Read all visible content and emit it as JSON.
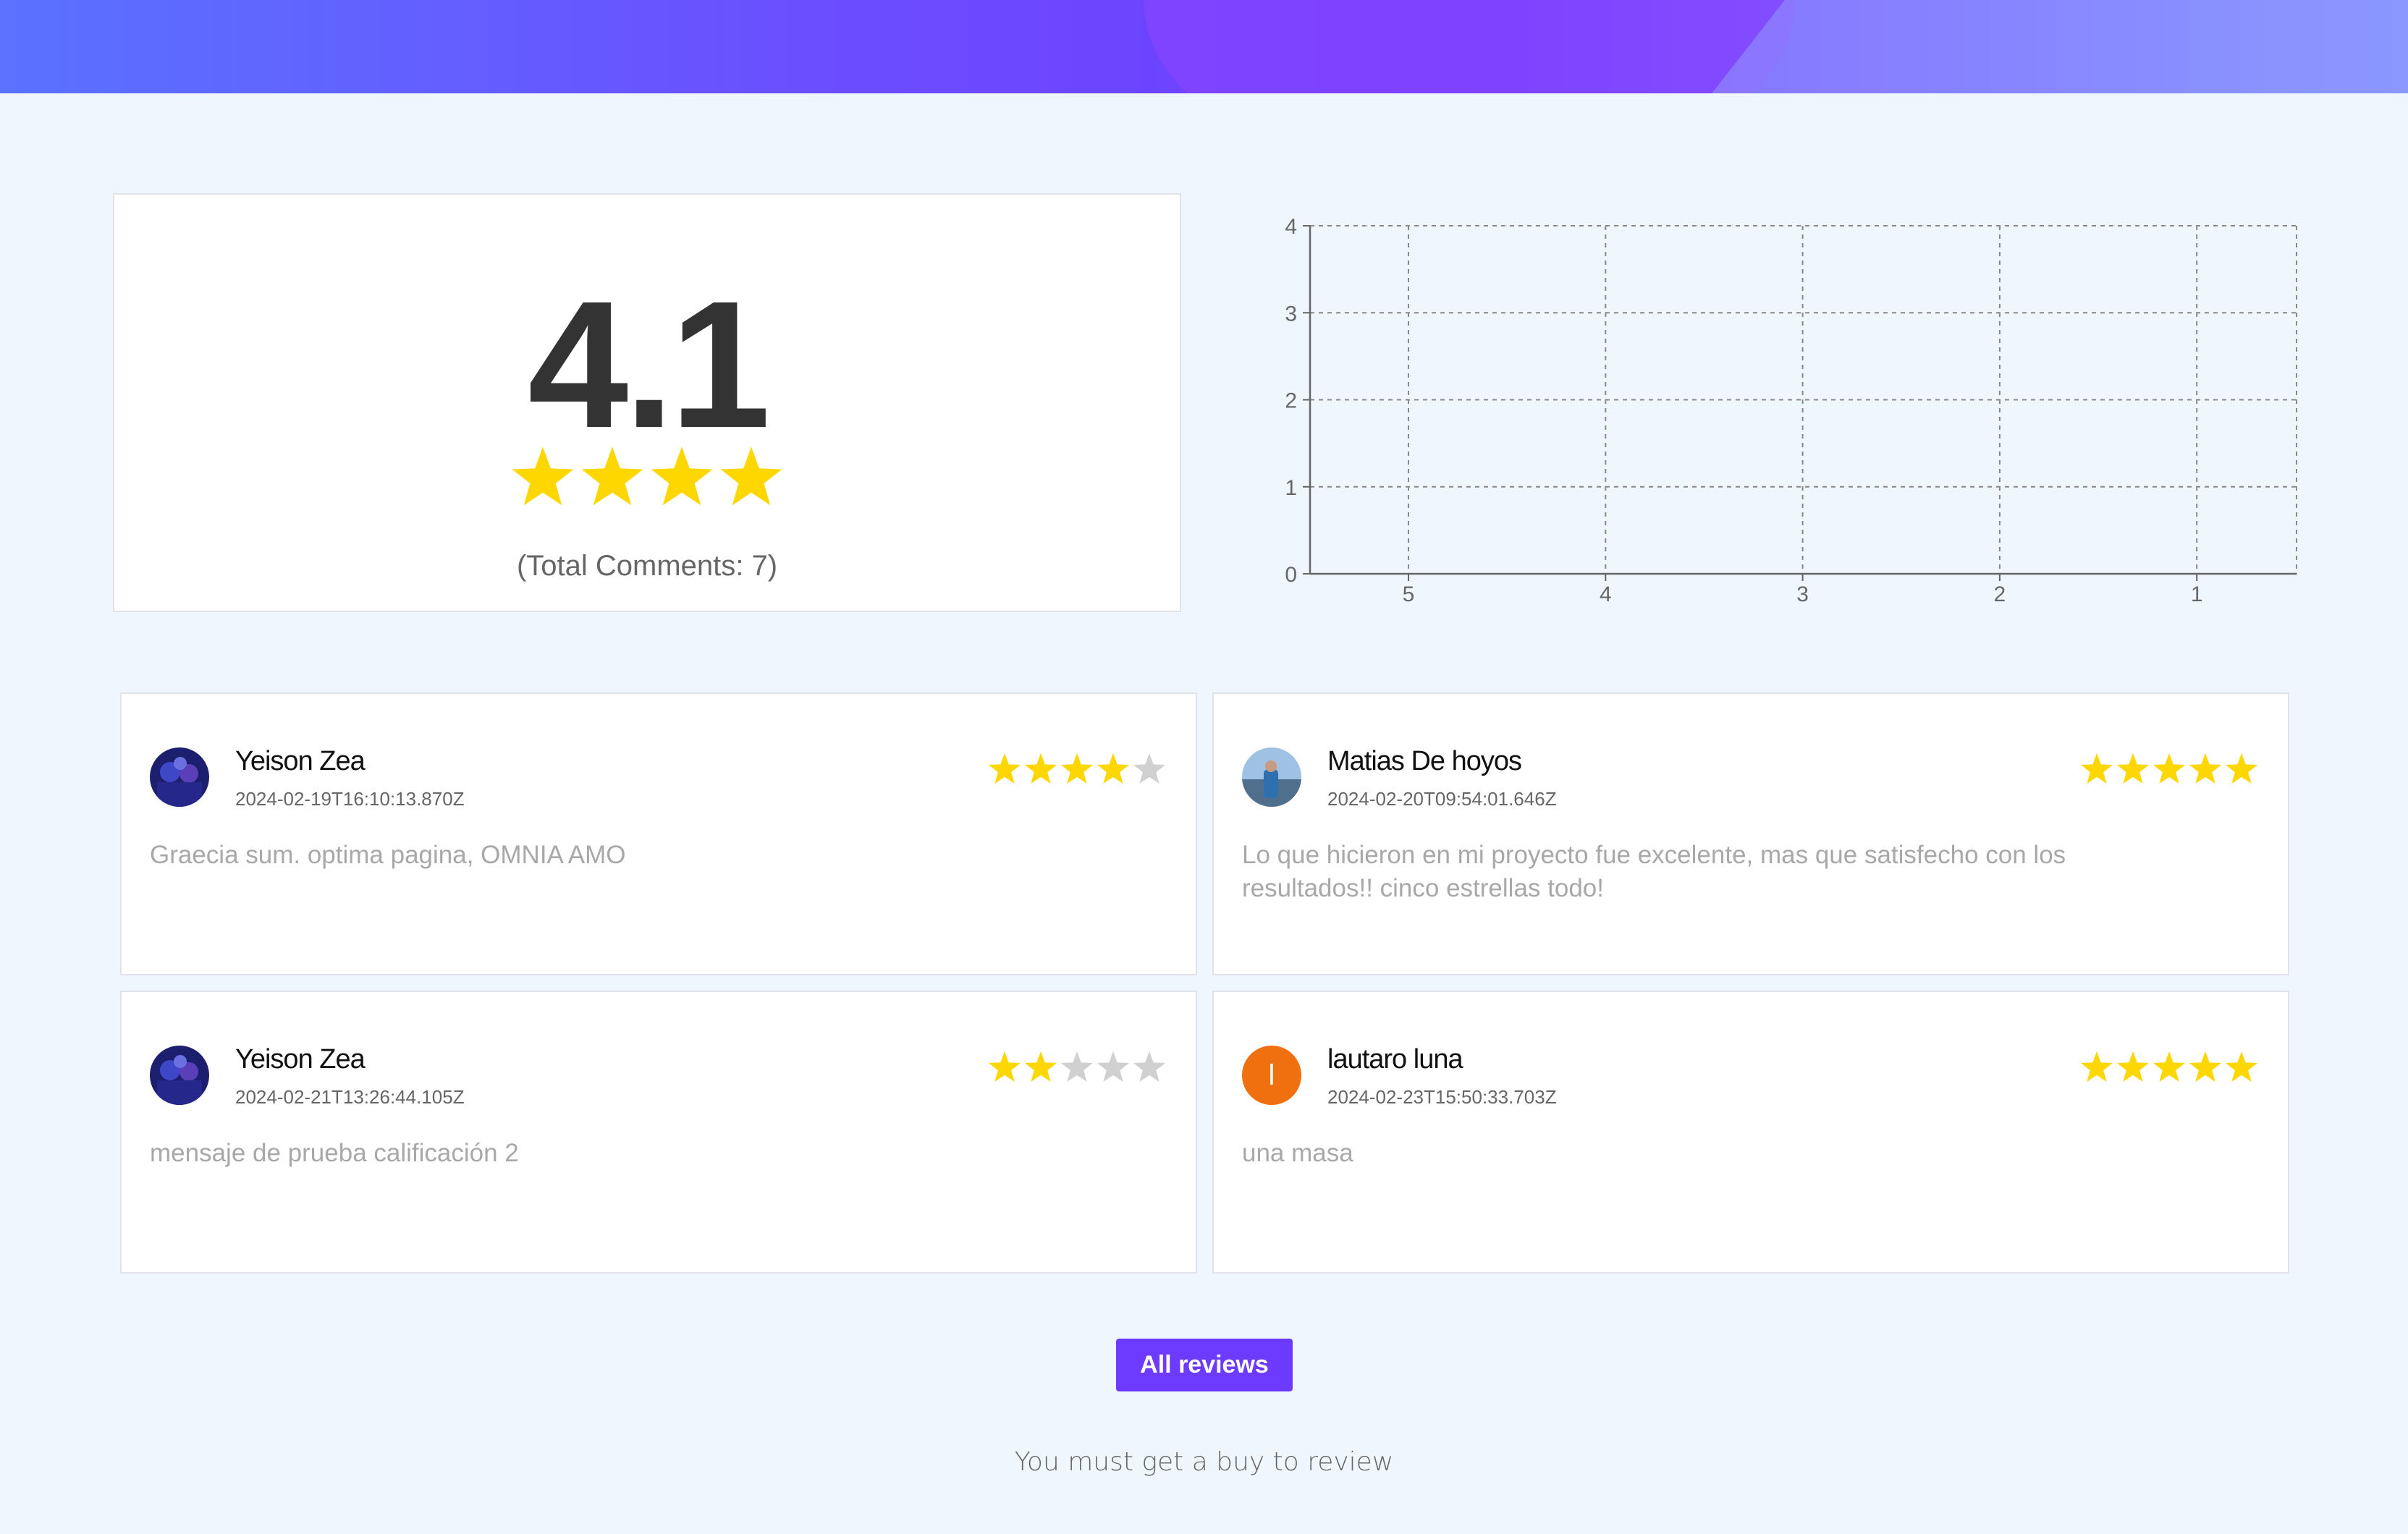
{
  "header": {
    "colors": {
      "start": "#5a72ff",
      "mid": "#6e3cff",
      "end": "#7f8aff"
    }
  },
  "summary": {
    "rating": "4.1",
    "filled_stars": 4,
    "total_comments": "(Total Comments: 7)",
    "star_color": "#ffd700"
  },
  "chart_data": {
    "type": "bar",
    "categories": [
      "5",
      "4",
      "3",
      "2",
      "1"
    ],
    "values": [
      0,
      0,
      0,
      0,
      0
    ],
    "ylim": [
      0,
      4
    ],
    "yticks": [
      "0",
      "1",
      "2",
      "3",
      "4"
    ],
    "grid": true
  },
  "reviews": [
    {
      "name": "Yeison Zea",
      "date": "2024-02-19T16:10:13.870Z",
      "rating": 4,
      "text": "Graecia sum. optima pagina, OMNIA AMO",
      "avatar": "photo-avatar-icon"
    },
    {
      "name": "Matias De hoyos",
      "date": "2024-02-20T09:54:01.646Z",
      "rating": 5,
      "text": "Lo que hicieron en mi proyecto fue excelente, mas que satisfecho con los resultados!! cinco estrellas todo!",
      "avatar": "photo-avatar-icon"
    },
    {
      "name": "Yeison Zea",
      "date": "2024-02-21T13:26:44.105Z",
      "rating": 2,
      "text": "mensaje de prueba calificación 2",
      "avatar": "photo-avatar-icon"
    },
    {
      "name": "lautaro luna",
      "date": "2024-02-23T15:50:33.703Z",
      "rating": 5,
      "text": "una masa",
      "avatar": "initial-avatar-icon",
      "initial": "l",
      "avatar_color": "#f07010"
    }
  ],
  "actions": {
    "all_reviews_label": "All reviews"
  },
  "footer": {
    "must_buy_text": "You must get a buy to review"
  }
}
